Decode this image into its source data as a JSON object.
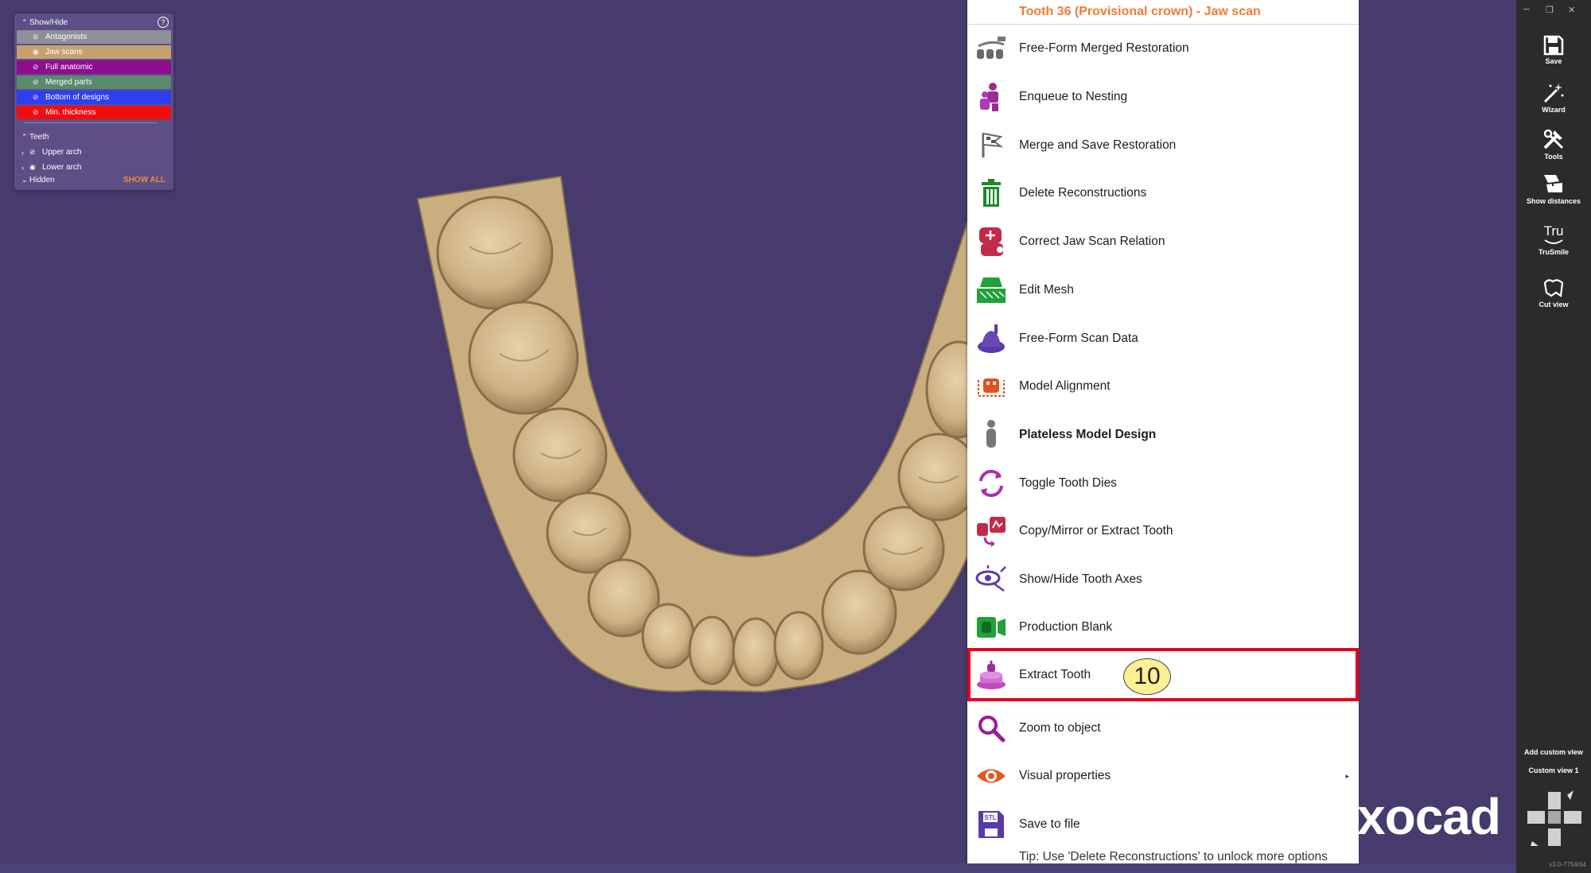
{
  "show_hide_panel": {
    "title": "Show/Hide",
    "layers": [
      {
        "label": "Antagonists",
        "color": "#8f8f98"
      },
      {
        "label": "Jaw scans",
        "color": "#c8a070"
      },
      {
        "label": "Full anatomic",
        "color": "#8e0e8e"
      },
      {
        "label": "Merged parts",
        "color": "#5a8a6e"
      },
      {
        "label": "Bottom of designs",
        "color": "#2e3ef2"
      },
      {
        "label": "Min. thickness",
        "color": "#f20d0d"
      }
    ],
    "teeth_title": "Teeth",
    "arches": [
      {
        "label": "Upper arch"
      },
      {
        "label": "Lower arch"
      }
    ],
    "hidden_label": "Hidden",
    "show_all_label": "SHOW ALL"
  },
  "context_menu": {
    "title": "Tooth 36 (Provisional crown) - Jaw scan",
    "items": [
      {
        "label": "Free-Form Merged Restoration",
        "icon": "free-form-merged-icon"
      },
      {
        "label": "Enqueue to Nesting",
        "icon": "nesting-icon"
      },
      {
        "label": "Merge and Save Restoration",
        "icon": "merge-save-icon"
      },
      {
        "label": "Delete Reconstructions",
        "icon": "trash-icon"
      },
      {
        "label": "Correct Jaw Scan Relation",
        "icon": "jaw-relation-icon"
      },
      {
        "label": "Edit Mesh",
        "icon": "edit-mesh-icon"
      },
      {
        "label": "Free-Form Scan Data",
        "icon": "free-form-scan-icon"
      },
      {
        "label": "Model Alignment",
        "icon": "model-alignment-icon"
      },
      {
        "label": "Plateless Model Design",
        "icon": "plateless-model-icon"
      },
      {
        "label": "Toggle Tooth Dies",
        "icon": "toggle-dies-icon"
      },
      {
        "label": "Copy/Mirror or Extract Tooth",
        "icon": "copy-mirror-icon"
      },
      {
        "label": "Show/Hide Tooth Axes",
        "icon": "tooth-axes-icon"
      },
      {
        "label": "Production Blank",
        "icon": "production-blank-icon"
      },
      {
        "label": "Extract Tooth",
        "icon": "extract-tooth-icon"
      },
      {
        "label": "Zoom to object",
        "icon": "zoom-icon"
      },
      {
        "label": "Visual properties",
        "icon": "eye-icon"
      },
      {
        "label": "Save to file",
        "icon": "stl-file-icon"
      }
    ],
    "step_badge": "10",
    "tip": "Tip: Use 'Delete Reconstructions' to unlock more options"
  },
  "brand": "xocad",
  "toolbar": {
    "items": [
      {
        "label": "Save",
        "icon": "save-icon"
      },
      {
        "label": "Wizard",
        "icon": "wizard-icon"
      },
      {
        "label": "Tools",
        "icon": "tools-icon"
      },
      {
        "label": "Show distances",
        "icon": "distances-icon"
      },
      {
        "label": "TruSmile",
        "icon": "trusmile-icon"
      },
      {
        "label": "Cut view",
        "icon": "cut-view-icon"
      }
    ],
    "add_custom_view": "Add custom view",
    "custom_view_1": "Custom view 1",
    "version": "v3.0-7754/64"
  },
  "colors": {
    "viewport_bg": "#463b6c",
    "menu_title": "#f07c33",
    "highlight": "#e3001b",
    "badge": "#ffee93",
    "jaw": "#d4b98c"
  }
}
